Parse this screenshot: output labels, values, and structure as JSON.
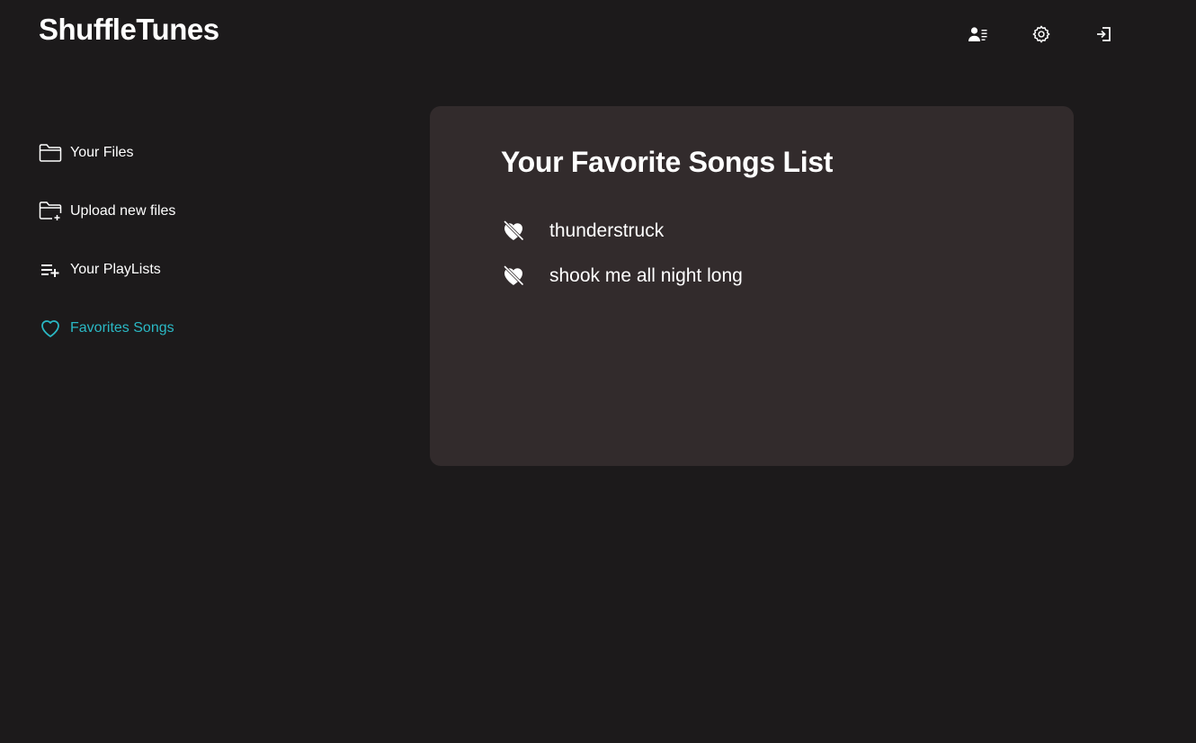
{
  "app": {
    "title": "ShuffleTunes"
  },
  "header": {
    "icons": [
      "user-list-icon",
      "gear-icon",
      "logout-icon"
    ]
  },
  "sidebar": {
    "items": [
      {
        "label": "Your Files",
        "icon": "folder-icon",
        "active": false
      },
      {
        "label": "Upload new files",
        "icon": "folder-plus-icon",
        "active": false
      },
      {
        "label": "Your PlayLists",
        "icon": "playlist-add-icon",
        "active": false
      },
      {
        "label": "Favorites Songs",
        "icon": "heart-outline-icon",
        "active": true
      }
    ]
  },
  "main": {
    "title": "Your Favorite Songs List",
    "songs": [
      {
        "title": "thunderstruck",
        "icon": "heart-off-icon"
      },
      {
        "title": "shook me all night long",
        "icon": "heart-off-icon"
      }
    ]
  },
  "colors": {
    "background": "#1c1a1b",
    "panel": "#322b2c",
    "accent": "#2ab8c4",
    "text": "#ffffff"
  }
}
